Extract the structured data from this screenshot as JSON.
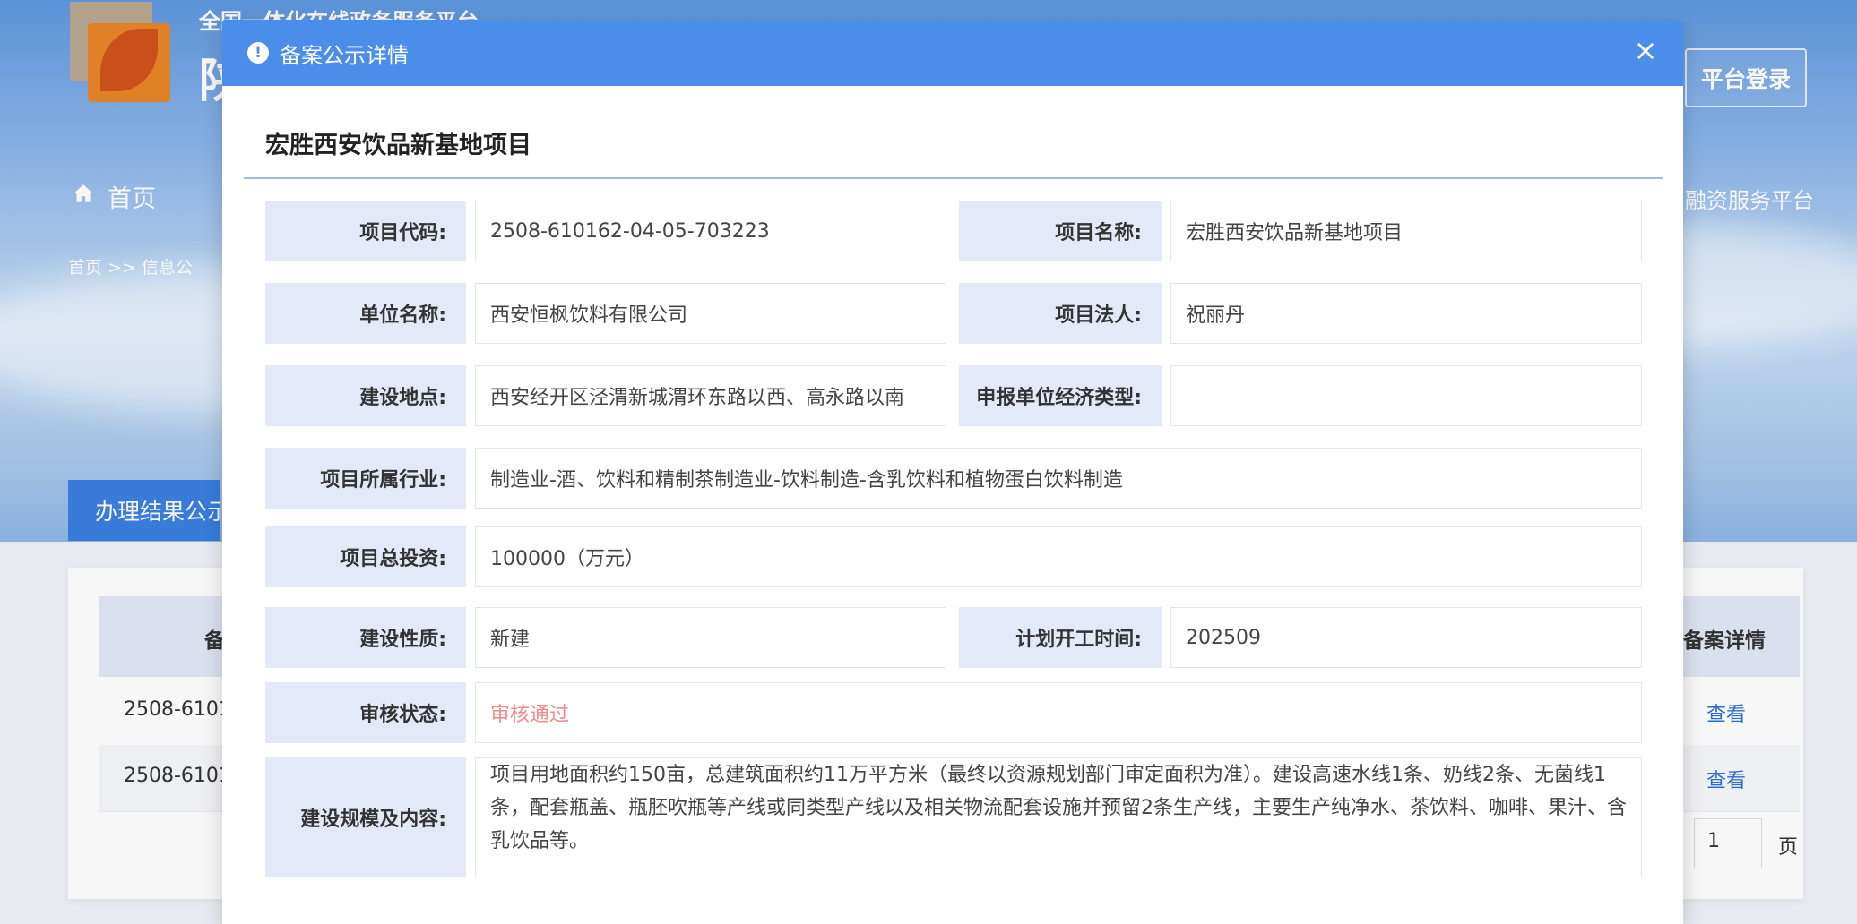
{
  "site": {
    "title_line1": "全国一体化在线政务服务平台",
    "title_line2": "陕",
    "login_button": "平台登录",
    "nav_home": "首页",
    "nav_right": "融资服务平台",
    "breadcrumb": "首页 >> 信息公",
    "tab_label": "办理结果公示"
  },
  "bg_table": {
    "header_left": "备",
    "header_right": "备案详情",
    "rows": [
      {
        "code": "2508-6101",
        "link": "查看"
      },
      {
        "code": "2508-6101",
        "link": "查看"
      }
    ],
    "pager_value": "1",
    "pager_unit": "页"
  },
  "modal": {
    "title": "备案公示详情",
    "close_symbol": "×",
    "project_heading": "宏胜西安饮品新基地项目",
    "fields": {
      "code_label": "项目代码:",
      "code_value": "2508-610162-04-05-703223",
      "name_label": "项目名称:",
      "name_value": "宏胜西安饮品新基地项目",
      "unit_label": "单位名称:",
      "unit_value": "西安恒枫饮料有限公司",
      "legal_label": "项目法人:",
      "legal_value": "祝丽丹",
      "location_label": "建设地点:",
      "location_value": "西安经开区泾渭新城渭环东路以西、高永路以南",
      "econ_label": "申报单位经济类型:",
      "econ_value": "",
      "industry_label": "项目所属行业:",
      "industry_value": "制造业-酒、饮料和精制茶制造业-饮料制造-含乳饮料和植物蛋白饮料制造",
      "investment_label": "项目总投资:",
      "investment_value": "100000（万元）",
      "nature_label": "建设性质:",
      "nature_value": "新建",
      "start_label": "计划开工时间:",
      "start_value": "202509",
      "status_label": "审核状态:",
      "status_value": "审核通过",
      "scope_label": "建设规模及内容:",
      "scope_value": "项目用地面积约150亩，总建筑面积约11万平方米（最终以资源规划部门审定面积为准）。建设高速水线1条、奶线2条、无菌线1条，配套瓶盖、瓶胚吹瓶等产线或同类型产线以及相关物流配套设施并预留2条生产线，主要生产纯净水、茶饮料、咖啡、果汁、含乳饮品等。"
    }
  },
  "colors": {
    "modal_header": "#4b8eea",
    "label_bg": "#e4e9f7",
    "status_text": "#f08a8a",
    "link": "#2f6fd6"
  }
}
